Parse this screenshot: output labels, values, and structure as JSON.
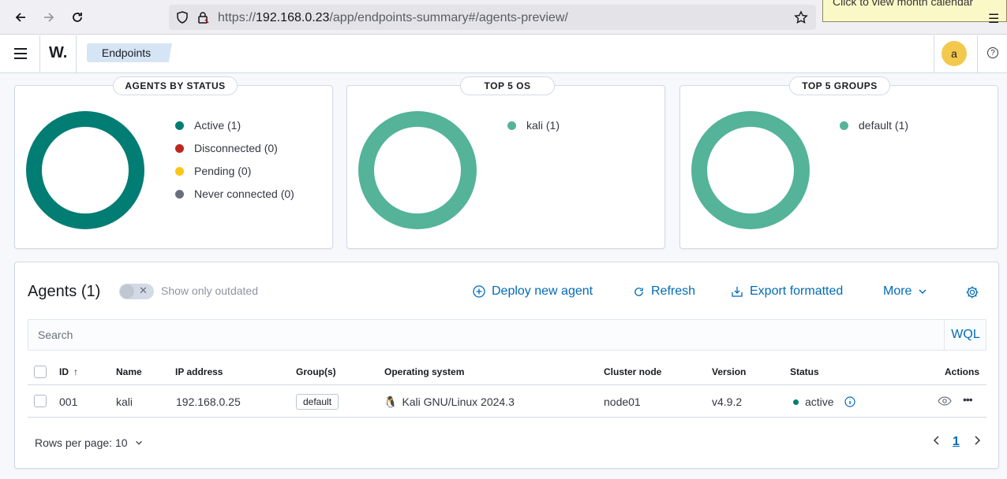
{
  "browser": {
    "url_prefix": "https://",
    "url_host": "192.168.0.23",
    "url_path": "/app/endpoints-summary#/agents-preview/",
    "tooltip": "Click to view month calendar"
  },
  "header": {
    "logo": "W.",
    "breadcrumb": "Endpoints",
    "avatar_letter": "a",
    "help_icon": "?"
  },
  "status_panel": {
    "title": "AGENTS BY STATUS",
    "legend": [
      {
        "label": "Active (1)",
        "color": "#017d73"
      },
      {
        "label": "Disconnected (0)",
        "color": "#bd271e"
      },
      {
        "label": "Pending (0)",
        "color": "#fec514"
      },
      {
        "label": "Never connected (0)",
        "color": "#69707d"
      }
    ],
    "donut_color": "#017d73"
  },
  "os_panel": {
    "title": "TOP 5 OS",
    "legend": [
      {
        "label": "kali (1)",
        "color": "#54b399"
      }
    ],
    "donut_color": "#54b399"
  },
  "groups_panel": {
    "title": "TOP 5 GROUPS",
    "legend": [
      {
        "label": "default (1)",
        "color": "#54b399"
      }
    ],
    "donut_color": "#54b399"
  },
  "agents": {
    "title": "Agents (1)",
    "toggle_label": "Show only outdated",
    "deploy_label": "Deploy new agent",
    "refresh_label": "Refresh",
    "export_label": "Export formatted",
    "more_label": "More",
    "search_placeholder": "Search",
    "wql_label": "WQL",
    "columns": {
      "id": "ID",
      "name": "Name",
      "ip": "IP address",
      "groups": "Group(s)",
      "os": "Operating system",
      "cluster": "Cluster node",
      "version": "Version",
      "status": "Status",
      "actions": "Actions"
    },
    "rows": [
      {
        "id": "001",
        "name": "kali",
        "ip": "192.168.0.25",
        "group": "default",
        "os": "Kali GNU/Linux 2024.3",
        "cluster": "node01",
        "version": "v4.9.2",
        "status": "active"
      }
    ],
    "rows_per_page": "Rows per page: 10",
    "current_page": "1"
  }
}
